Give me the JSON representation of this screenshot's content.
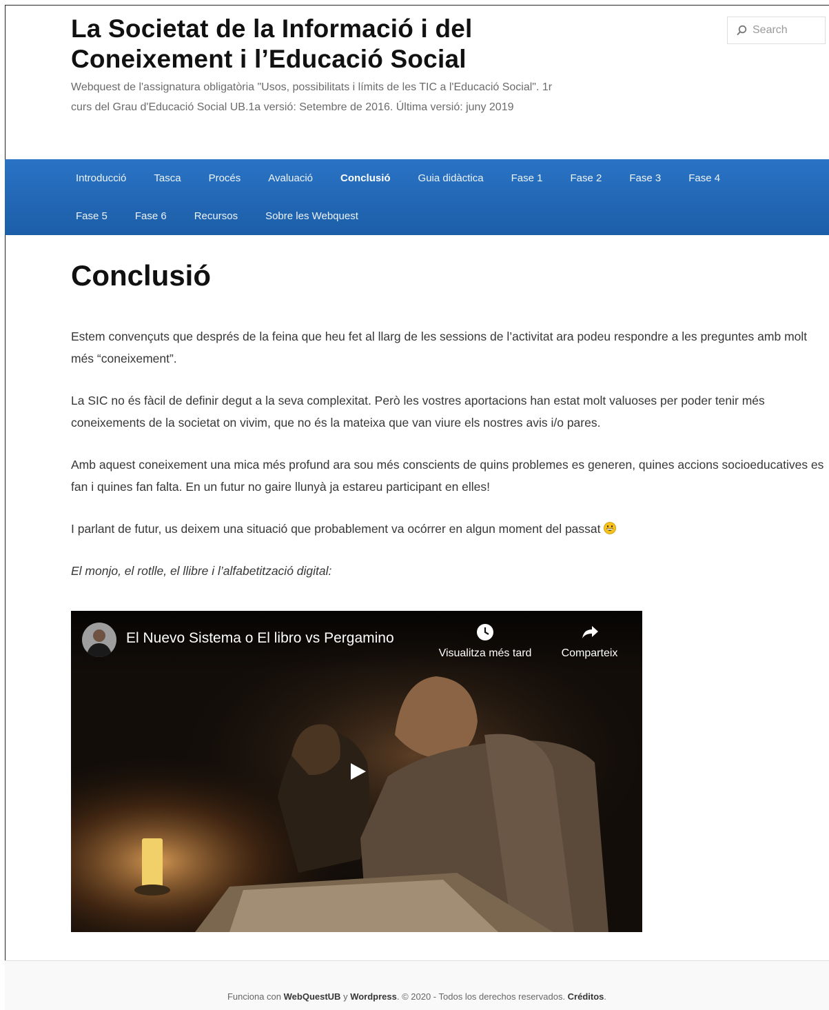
{
  "site": {
    "title": "La Societat de la Informació i del Coneixement i l’Educació Social",
    "description": "Webquest de l'assignatura obligatòria \"Usos, possibilitats i límits de les TIC a l'Educació Social\". 1r curs del Grau d'Educació Social UB.1a versió: Setembre de 2016. Última versió: juny 2019"
  },
  "search": {
    "placeholder": "Search"
  },
  "nav": {
    "row1": [
      "Introducció",
      "Tasca",
      "Procés",
      "Avaluació",
      "Conclusió",
      "Guia didàctica",
      "Fase 1",
      "Fase 2",
      "Fase 3",
      "Fase 4"
    ],
    "row2": [
      "Fase 5",
      "Fase 6",
      "Recursos",
      "Sobre les Webquest"
    ],
    "active": "Conclusió"
  },
  "page": {
    "title": "Conclusió",
    "paragraphs": [
      "Estem convençuts que després de la feina que heu fet al llarg de les sessions de l’activitat ara podeu respondre a les preguntes amb molt més “coneixement”.",
      "La SIC no és fàcil de definir degut a la seva complexitat. Però les vostres aportacions han estat molt valuoses per poder tenir més coneixements de la societat on vivim, que no és la mateixa que van viure els nostres avis i/o pares.",
      "Amb aquest coneixement una mica més profund ara sou més conscients de quins problemes es generen, quines accions socioeducatives es fan i quines fan falta. En un futur no gaire llunyà ja estareu participant en elles!",
      "I parlant de futur, us deixem una situació que probablement va ocórrer en algun moment del passat"
    ],
    "italic_caption": "El monjo, el rotlle, el llibre i l’alfabetització digital:"
  },
  "video": {
    "title": "El Nuevo Sistema o El libro vs Pergamino",
    "watch_later": "Visualitza més tard",
    "share": "Comparteix"
  },
  "footer": {
    "prefix": "Funciona con ",
    "webquest": "WebQuestUB",
    "sep": " y ",
    "wordpress": "Wordpress",
    "rights": ". © 2020 - Todos los derechos reservados. ",
    "credits": "Créditos",
    "end": "."
  },
  "colors": {
    "nav_bg": "#1c5ea8",
    "nav_text": "#eef4fb"
  }
}
